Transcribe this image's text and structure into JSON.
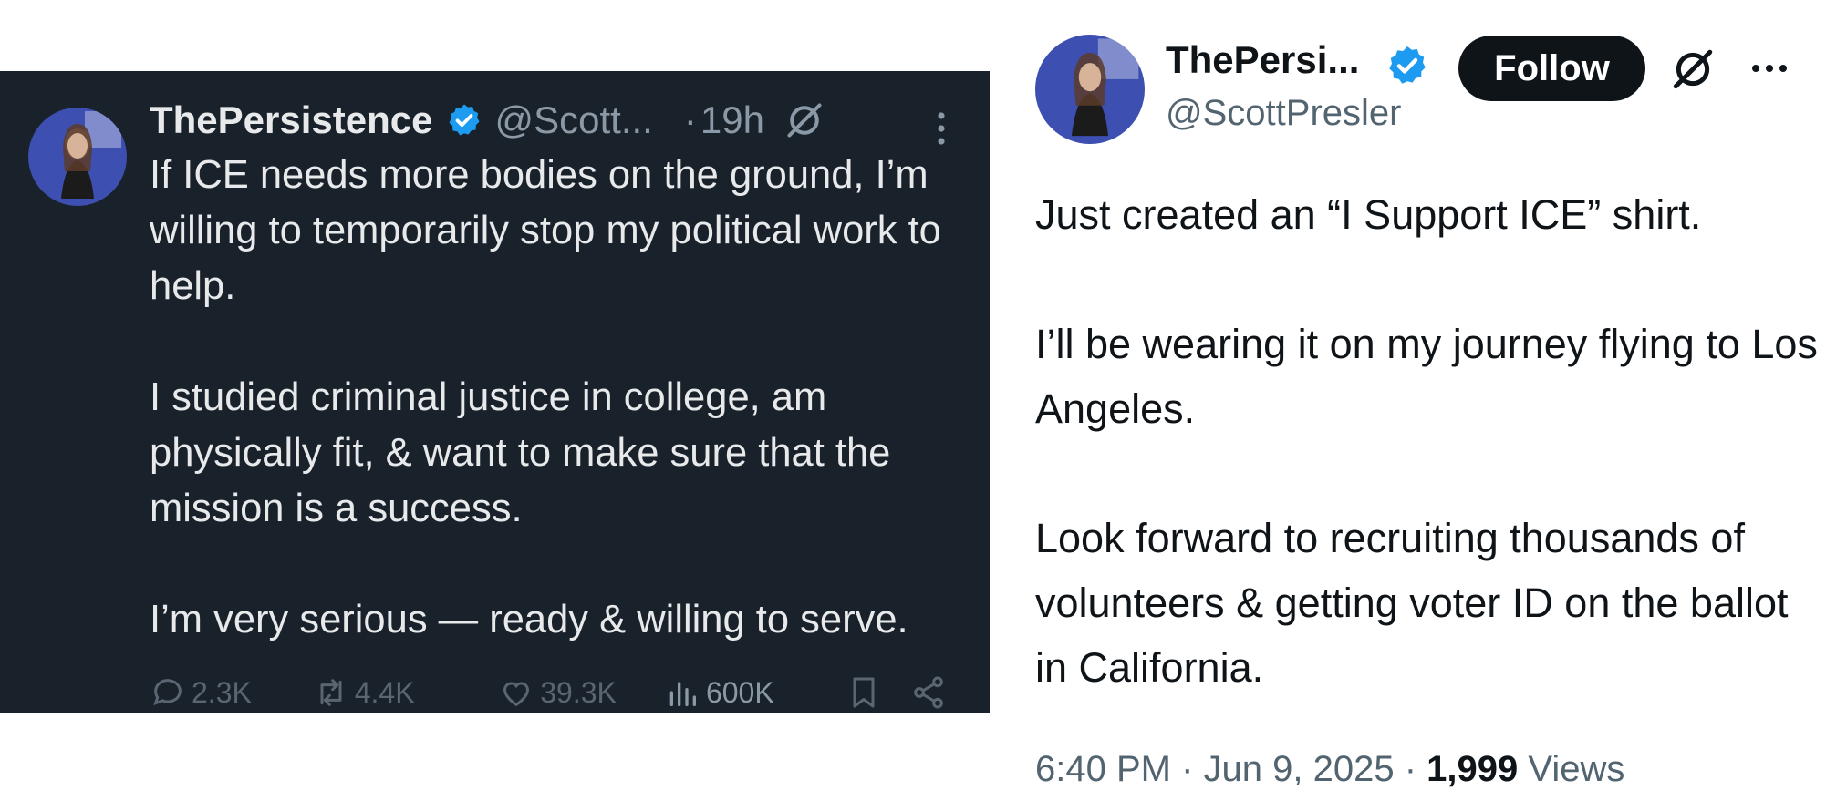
{
  "left_tweet": {
    "display_name": "ThePersistence",
    "handle": "@Scott...",
    "separator": "·",
    "time": "19h",
    "paragraphs": [
      "If ICE needs more bodies on the ground, I’m willing to temporarily stop my political work to help.",
      "I studied criminal justice in college, am physically fit, & want to make sure that the mission is a success.",
      "I’m very serious — ready & willing to serve."
    ],
    "actions": {
      "replies": "2.3K",
      "reposts": "4.4K",
      "likes": "39.3K",
      "views": "600K"
    },
    "icons": [
      "verified-badge-icon",
      "grok-icon",
      "more-vertical-icon",
      "reply-icon",
      "repost-icon",
      "like-icon",
      "views-icon",
      "bookmark-icon",
      "share-icon"
    ]
  },
  "right_tweet": {
    "display_name": "ThePersi...",
    "handle": "@ScottPresler",
    "follow_label": "Follow",
    "paragraphs": [
      "Just created an “I Support ICE” shirt.",
      "I’ll be wearing it on my journey flying to Los Angeles.",
      "Look forward to recruiting thousands of volunteers & getting voter ID on the ballot in California."
    ],
    "time": "6:40 PM",
    "date": "Jun 9, 2025",
    "views_count": "1,999",
    "views_label": "Views",
    "icons": [
      "verified-badge-icon",
      "grok-icon",
      "more-horizontal-icon"
    ]
  },
  "colors": {
    "dark_bg": "#19212b",
    "verified_blue": "#1d9bf0",
    "text_dark": "#0f1419",
    "text_muted": "#536471"
  }
}
